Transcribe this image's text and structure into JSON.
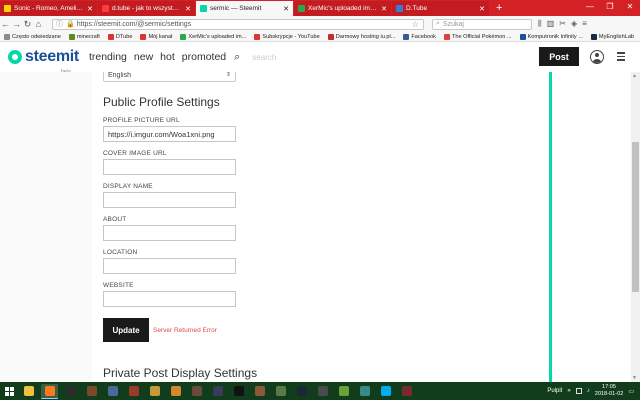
{
  "browser": {
    "tabs": [
      {
        "title": "Sonic - Romeo, Amelia... i nie t",
        "color": "#ffd400",
        "active": false
      },
      {
        "title": "d.tube - jak to wszystko działa",
        "color": "#ff3b3b",
        "active": false
      },
      {
        "title": "sermic — Steemit",
        "color": "#06d6a9",
        "active": true
      },
      {
        "title": "XerMic's uploaded images - Im",
        "color": "#2aa84a",
        "active": false
      },
      {
        "title": "D.Tube",
        "color": "#3b7bd8",
        "active": false
      }
    ],
    "new_tab": "+",
    "url": "https://steemit.com/@sermic/settings",
    "search_placeholder": "Szukaj",
    "bookmarks": [
      {
        "label": "Często odwiedzane",
        "color": "#8a8a8a"
      },
      {
        "label": "minecraft",
        "color": "#5b8a2b"
      },
      {
        "label": "DTube",
        "color": "#d33"
      },
      {
        "label": "Mój kanał",
        "color": "#d33"
      },
      {
        "label": "XerMic's uploaded im...",
        "color": "#2aa84a"
      },
      {
        "label": "Subskrypcje - YouTube",
        "color": "#d33"
      },
      {
        "label": "Darmowy hosting iu.pl...",
        "color": "#c03030"
      },
      {
        "label": "Facebook",
        "color": "#3b5998"
      },
      {
        "label": "The Official Pokémon ...",
        "color": "#e04040"
      },
      {
        "label": "Komputronik Infinity ...",
        "color": "#1e4fa0"
      },
      {
        "label": "MyEnglishLab",
        "color": "#1a2a4a"
      }
    ]
  },
  "header": {
    "logo_text": "steemit",
    "logo_beta": "beta",
    "nav": [
      "trending",
      "new",
      "hot",
      "promoted"
    ],
    "search_placeholder": "search",
    "post_button": "Post"
  },
  "settings": {
    "language_value": "English",
    "public_profile_title": "Public Profile Settings",
    "fields": [
      {
        "label": "PROFILE PICTURE URL",
        "value": "https://i.imgur.com/Woa1xni.png"
      },
      {
        "label": "COVER IMAGE URL",
        "value": ""
      },
      {
        "label": "DISPLAY NAME",
        "value": ""
      },
      {
        "label": "ABOUT",
        "value": ""
      },
      {
        "label": "LOCATION",
        "value": ""
      },
      {
        "label": "WEBSITE",
        "value": ""
      }
    ],
    "update_button": "Update",
    "error_message": "Server Returned Error",
    "private_title": "Private Post Display Settings"
  },
  "taskbar": {
    "apps": [
      {
        "name": "file-explorer",
        "color": "#f0c040",
        "active": false
      },
      {
        "name": "firefox",
        "color": "#ff7a1a",
        "active": true
      },
      {
        "name": "batman-game",
        "color": "#2b2b2b",
        "active": false
      },
      {
        "name": "game-1",
        "color": "#7a4a2a",
        "active": false
      },
      {
        "name": "game-2",
        "color": "#4a6a9a",
        "active": false
      },
      {
        "name": "game-3",
        "color": "#9a3a2a",
        "active": false
      },
      {
        "name": "game-4",
        "color": "#c49a3a",
        "active": false
      },
      {
        "name": "jurassic-game",
        "color": "#d08a2a",
        "active": false
      },
      {
        "name": "game-5",
        "color": "#6a4a3a",
        "active": false
      },
      {
        "name": "game-6",
        "color": "#3a3a5a",
        "active": false
      },
      {
        "name": "vader-game",
        "color": "#111111",
        "active": false
      },
      {
        "name": "game-7",
        "color": "#8a5a3a",
        "active": false
      },
      {
        "name": "game-8",
        "color": "#5a7a4a",
        "active": false
      },
      {
        "name": "steam",
        "color": "#1b2838",
        "active": false
      },
      {
        "name": "game-9",
        "color": "#4a4a4a",
        "active": false
      },
      {
        "name": "minecraft",
        "color": "#6aa33a",
        "active": false
      },
      {
        "name": "game-10",
        "color": "#3a8a8a",
        "active": false
      },
      {
        "name": "skype",
        "color": "#00aff0",
        "active": false
      },
      {
        "name": "game-11",
        "color": "#7a2a2a",
        "active": false
      }
    ],
    "desktop_label": "Pulpit",
    "time": "17:05",
    "date": "2018-01-02"
  }
}
